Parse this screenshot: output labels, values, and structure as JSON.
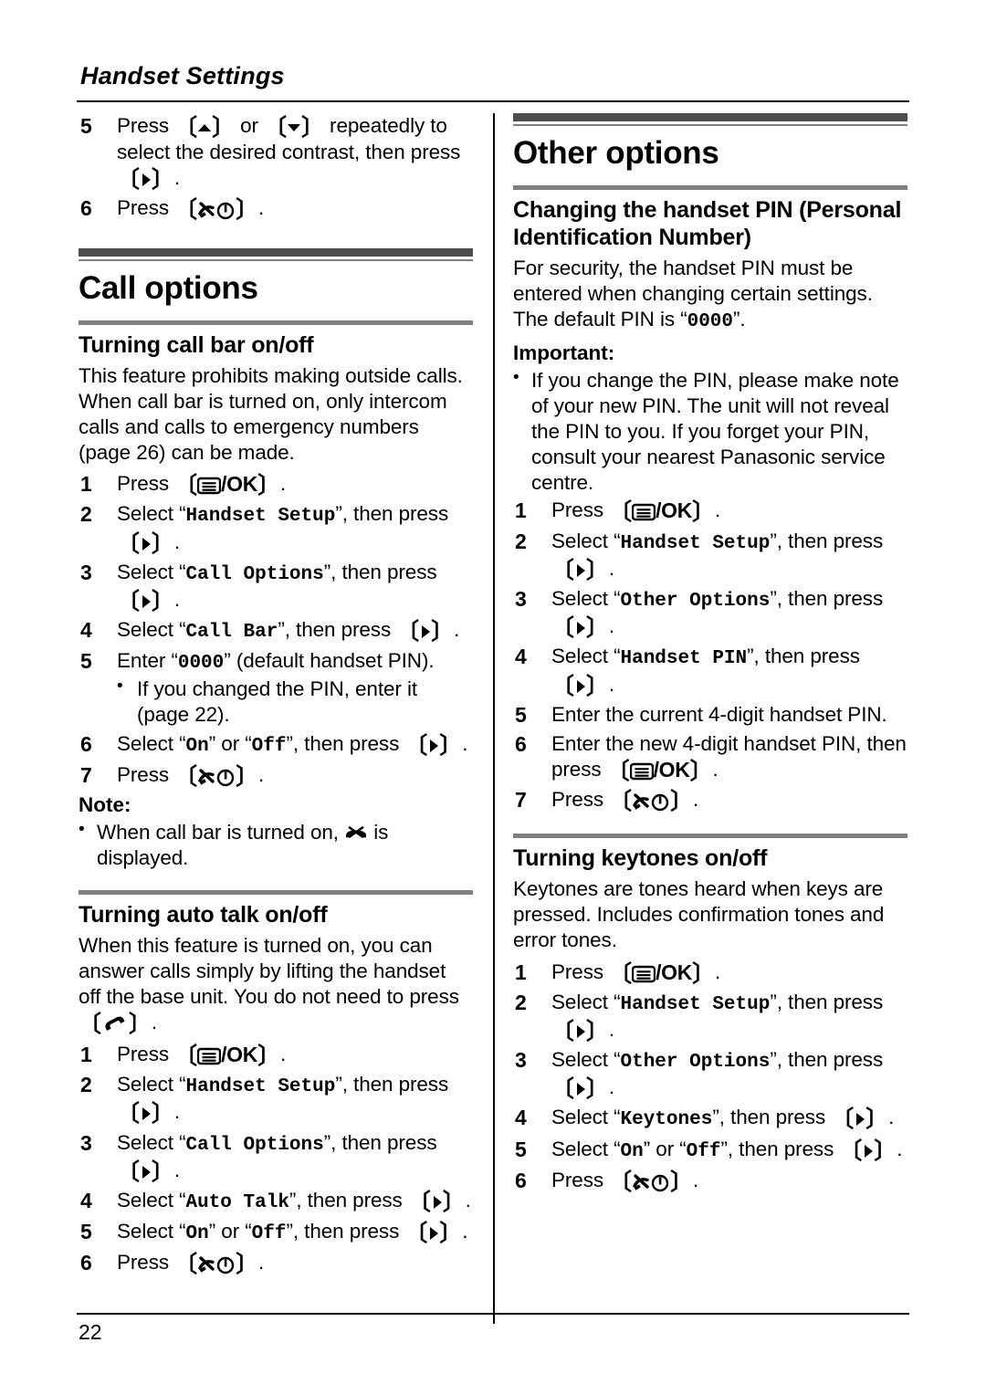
{
  "document": {
    "running_head": "Handset Settings",
    "page_number": "22"
  },
  "icons": {
    "up_key": "up-arrow-key-icon",
    "down_key": "down-arrow-key-icon",
    "right_key": "right-arrow-key-icon",
    "menu_ok_key": "menu-ok-key-icon",
    "power_off_key": "power-off-key-icon",
    "talk_key": "talk-key-icon",
    "call_bar_display": "call-bar-display-icon"
  },
  "left_column": {
    "continued_steps": [
      {
        "number": "5",
        "parts": [
          {
            "t": "text",
            "v": "Press "
          },
          {
            "t": "key",
            "v": "up_key"
          },
          {
            "t": "text",
            "v": " or "
          },
          {
            "t": "key",
            "v": "down_key"
          },
          {
            "t": "text",
            "v": " repeatedly to select the desired contrast, then press "
          },
          {
            "t": "key",
            "v": "right_key"
          },
          {
            "t": "text",
            "v": "."
          }
        ]
      },
      {
        "number": "6",
        "parts": [
          {
            "t": "text",
            "v": "Press "
          },
          {
            "t": "key",
            "v": "power_off_key"
          },
          {
            "t": "text",
            "v": "."
          }
        ]
      }
    ],
    "chapter": {
      "title": "Call options"
    },
    "sections": [
      {
        "title": "Turning call bar on/off",
        "intro": "This feature prohibits making outside calls. When call bar is turned on, only intercom calls and calls to emergency numbers (page 26) can be made.",
        "steps": [
          {
            "number": "1",
            "parts": [
              {
                "t": "text",
                "v": "Press "
              },
              {
                "t": "key",
                "v": "menu_ok_key"
              },
              {
                "t": "text",
                "v": "."
              }
            ]
          },
          {
            "number": "2",
            "parts": [
              {
                "t": "text",
                "v": "Select "
              },
              {
                "t": "mono",
                "v": "Handset Setup"
              },
              {
                "t": "text",
                "v": ", then press "
              },
              {
                "t": "key",
                "v": "right_key"
              },
              {
                "t": "text",
                "v": "."
              }
            ]
          },
          {
            "number": "3",
            "parts": [
              {
                "t": "text",
                "v": "Select "
              },
              {
                "t": "mono",
                "v": "Call Options"
              },
              {
                "t": "text",
                "v": ", then press "
              },
              {
                "t": "key",
                "v": "right_key"
              },
              {
                "t": "text",
                "v": "."
              }
            ]
          },
          {
            "number": "4",
            "parts": [
              {
                "t": "text",
                "v": "Select "
              },
              {
                "t": "mono",
                "v": "Call Bar"
              },
              {
                "t": "text",
                "v": ", then press "
              },
              {
                "t": "key",
                "v": "right_key"
              },
              {
                "t": "text",
                "v": "."
              }
            ]
          },
          {
            "number": "5",
            "parts": [
              {
                "t": "text",
                "v": "Enter "
              },
              {
                "t": "mono",
                "v": "0000"
              },
              {
                "t": "text",
                "v": " (default handset PIN)."
              }
            ],
            "bullets": [
              "If you changed the PIN, enter it (page 22)."
            ]
          },
          {
            "number": "6",
            "parts": [
              {
                "t": "text",
                "v": "Select "
              },
              {
                "t": "mono",
                "v": "On"
              },
              {
                "t": "text",
                "v": " or "
              },
              {
                "t": "mono",
                "v": "Off"
              },
              {
                "t": "text",
                "v": ", then press "
              },
              {
                "t": "key",
                "v": "right_key"
              },
              {
                "t": "text",
                "v": "."
              }
            ]
          },
          {
            "number": "7",
            "parts": [
              {
                "t": "text",
                "v": "Press "
              },
              {
                "t": "key",
                "v": "power_off_key"
              },
              {
                "t": "text",
                "v": "."
              }
            ]
          }
        ],
        "note_label": "Note:",
        "note_bullet_parts": [
          {
            "t": "text",
            "v": "When call bar is turned on, "
          },
          {
            "t": "key",
            "v": "call_bar_display"
          },
          {
            "t": "text",
            "v": " is displayed."
          }
        ]
      },
      {
        "title": "Turning auto talk on/off",
        "intro_parts": [
          {
            "t": "text",
            "v": "When this feature is turned on, you can answer calls simply by lifting the handset off the base unit. You do not need to press "
          },
          {
            "t": "key",
            "v": "talk_key"
          },
          {
            "t": "text",
            "v": "."
          }
        ],
        "steps": [
          {
            "number": "1",
            "parts": [
              {
                "t": "text",
                "v": "Press "
              },
              {
                "t": "key",
                "v": "menu_ok_key"
              },
              {
                "t": "text",
                "v": "."
              }
            ]
          },
          {
            "number": "2",
            "parts": [
              {
                "t": "text",
                "v": "Select "
              },
              {
                "t": "mono",
                "v": "Handset Setup"
              },
              {
                "t": "text",
                "v": ", then press "
              },
              {
                "t": "key",
                "v": "right_key"
              },
              {
                "t": "text",
                "v": "."
              }
            ]
          },
          {
            "number": "3",
            "parts": [
              {
                "t": "text",
                "v": "Select "
              },
              {
                "t": "mono",
                "v": "Call Options"
              },
              {
                "t": "text",
                "v": ", then press "
              },
              {
                "t": "key",
                "v": "right_key"
              },
              {
                "t": "text",
                "v": "."
              }
            ]
          },
          {
            "number": "4",
            "parts": [
              {
                "t": "text",
                "v": "Select "
              },
              {
                "t": "mono",
                "v": "Auto Talk"
              },
              {
                "t": "text",
                "v": ", then press "
              },
              {
                "t": "key",
                "v": "right_key"
              },
              {
                "t": "text",
                "v": "."
              }
            ]
          },
          {
            "number": "5",
            "parts": [
              {
                "t": "text",
                "v": "Select "
              },
              {
                "t": "mono",
                "v": "On"
              },
              {
                "t": "text",
                "v": " or "
              },
              {
                "t": "mono",
                "v": "Off"
              },
              {
                "t": "text",
                "v": ", then press "
              },
              {
                "t": "key",
                "v": "right_key"
              },
              {
                "t": "text",
                "v": "."
              }
            ]
          },
          {
            "number": "6",
            "parts": [
              {
                "t": "text",
                "v": "Press "
              },
              {
                "t": "key",
                "v": "power_off_key"
              },
              {
                "t": "text",
                "v": "."
              }
            ]
          }
        ]
      }
    ]
  },
  "right_column": {
    "chapter": {
      "title": "Other options"
    },
    "sections": [
      {
        "title": "Changing the handset PIN (Personal Identification Number)",
        "intro_parts": [
          {
            "t": "text",
            "v": "For security, the handset PIN must be entered when changing certain settings. The default PIN is "
          },
          {
            "t": "mono",
            "v": "0000"
          },
          {
            "t": "text",
            "v": "."
          }
        ],
        "important_label": "Important:",
        "important_bullets": [
          "If you change the PIN, please make note of your new PIN. The unit will not reveal the PIN to you. If you forget your PIN, consult your nearest Panasonic service centre."
        ],
        "steps": [
          {
            "number": "1",
            "parts": [
              {
                "t": "text",
                "v": "Press "
              },
              {
                "t": "key",
                "v": "menu_ok_key"
              },
              {
                "t": "text",
                "v": "."
              }
            ]
          },
          {
            "number": "2",
            "parts": [
              {
                "t": "text",
                "v": "Select "
              },
              {
                "t": "mono",
                "v": "Handset Setup"
              },
              {
                "t": "text",
                "v": ", then press "
              },
              {
                "t": "key",
                "v": "right_key"
              },
              {
                "t": "text",
                "v": "."
              }
            ]
          },
          {
            "number": "3",
            "parts": [
              {
                "t": "text",
                "v": "Select "
              },
              {
                "t": "mono",
                "v": "Other Options"
              },
              {
                "t": "text",
                "v": ", then press "
              },
              {
                "t": "key",
                "v": "right_key"
              },
              {
                "t": "text",
                "v": "."
              }
            ]
          },
          {
            "number": "4",
            "parts": [
              {
                "t": "text",
                "v": "Select "
              },
              {
                "t": "mono",
                "v": "Handset PIN"
              },
              {
                "t": "text",
                "v": ", then press "
              },
              {
                "t": "key",
                "v": "right_key"
              },
              {
                "t": "text",
                "v": "."
              }
            ]
          },
          {
            "number": "5",
            "parts": [
              {
                "t": "text",
                "v": "Enter the current 4-digit handset PIN."
              }
            ]
          },
          {
            "number": "6",
            "parts": [
              {
                "t": "text",
                "v": "Enter the new 4-digit handset PIN, then press "
              },
              {
                "t": "key",
                "v": "menu_ok_key"
              },
              {
                "t": "text",
                "v": "."
              }
            ]
          },
          {
            "number": "7",
            "parts": [
              {
                "t": "text",
                "v": "Press "
              },
              {
                "t": "key",
                "v": "power_off_key"
              },
              {
                "t": "text",
                "v": "."
              }
            ]
          }
        ]
      },
      {
        "title": "Turning keytones on/off",
        "intro": "Keytones are tones heard when keys are pressed. Includes confirmation tones and error tones.",
        "steps": [
          {
            "number": "1",
            "parts": [
              {
                "t": "text",
                "v": "Press "
              },
              {
                "t": "key",
                "v": "menu_ok_key"
              },
              {
                "t": "text",
                "v": "."
              }
            ]
          },
          {
            "number": "2",
            "parts": [
              {
                "t": "text",
                "v": "Select "
              },
              {
                "t": "mono",
                "v": "Handset Setup"
              },
              {
                "t": "text",
                "v": ", then press "
              },
              {
                "t": "key",
                "v": "right_key"
              },
              {
                "t": "text",
                "v": "."
              }
            ]
          },
          {
            "number": "3",
            "parts": [
              {
                "t": "text",
                "v": "Select "
              },
              {
                "t": "mono",
                "v": "Other Options"
              },
              {
                "t": "text",
                "v": ", then press "
              },
              {
                "t": "key",
                "v": "right_key"
              },
              {
                "t": "text",
                "v": "."
              }
            ]
          },
          {
            "number": "4",
            "parts": [
              {
                "t": "text",
                "v": "Select "
              },
              {
                "t": "mono",
                "v": "Keytones"
              },
              {
                "t": "text",
                "v": ", then press "
              },
              {
                "t": "key",
                "v": "right_key"
              },
              {
                "t": "text",
                "v": "."
              }
            ]
          },
          {
            "number": "5",
            "parts": [
              {
                "t": "text",
                "v": "Select "
              },
              {
                "t": "mono",
                "v": "On"
              },
              {
                "t": "text",
                "v": " or "
              },
              {
                "t": "mono",
                "v": "Off"
              },
              {
                "t": "text",
                "v": ", then press "
              },
              {
                "t": "key",
                "v": "right_key"
              },
              {
                "t": "text",
                "v": "."
              }
            ]
          },
          {
            "number": "6",
            "parts": [
              {
                "t": "text",
                "v": "Press "
              },
              {
                "t": "key",
                "v": "power_off_key"
              },
              {
                "t": "text",
                "v": "."
              }
            ]
          }
        ]
      }
    ]
  }
}
